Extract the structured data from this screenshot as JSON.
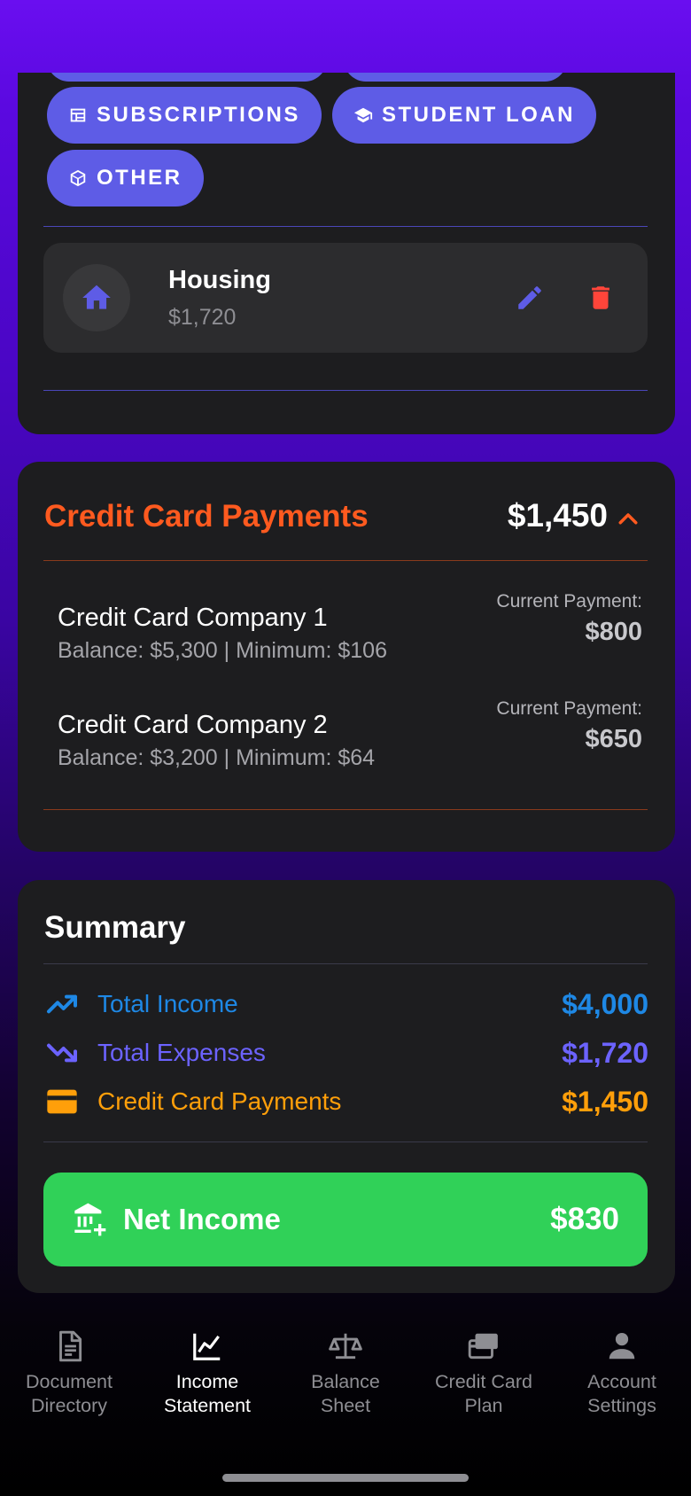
{
  "categories": {
    "chips": [
      {
        "label": "SUBSCRIPTIONS",
        "icon": "calendar-table-icon"
      },
      {
        "label": "STUDENT LOAN",
        "icon": "graduation-cap-icon"
      },
      {
        "label": "OTHER",
        "icon": "cube-icon"
      }
    ],
    "expense_item": {
      "name": "Housing",
      "amount": "$1,720",
      "icon": "home-icon"
    }
  },
  "credit_cards": {
    "title": "Credit Card Payments",
    "total": "$1,450",
    "payment_label": "Current Payment:",
    "items": [
      {
        "name": "Credit Card Company 1",
        "detail": "Balance: $5,300 | Minimum: $106",
        "payment": "$800"
      },
      {
        "name": "Credit Card Company 2",
        "detail": "Balance: $3,200 | Minimum: $64",
        "payment": "$650"
      }
    ]
  },
  "summary": {
    "title": "Summary",
    "rows": [
      {
        "label": "Total Income",
        "value": "$4,000",
        "color": "#1e88e5",
        "icon": "trending-up-icon"
      },
      {
        "label": "Total Expenses",
        "value": "$1,720",
        "color": "#6c63ff",
        "icon": "trending-down-icon"
      },
      {
        "label": "Credit Card Payments",
        "value": "$1,450",
        "color": "#ff9f0a",
        "icon": "credit-card-icon"
      }
    ],
    "net_income": {
      "label": "Net Income",
      "value": "$830",
      "color": "#30d158"
    }
  },
  "tabs": [
    {
      "label": "Document\nDirectory",
      "icon": "document-icon",
      "active": false
    },
    {
      "label": "Income\nStatement",
      "icon": "chart-line-icon",
      "active": true
    },
    {
      "label": "Balance\nSheet",
      "icon": "scale-icon",
      "active": false
    },
    {
      "label": "Credit Card\nPlan",
      "icon": "credit-cards-icon",
      "active": false
    },
    {
      "label": "Account\nSettings",
      "icon": "account-icon",
      "active": false
    }
  ],
  "colors": {
    "accent": "#5e5ce6",
    "danger": "#ff453a",
    "cc_title": "#ff5a1f",
    "success": "#30d158"
  }
}
